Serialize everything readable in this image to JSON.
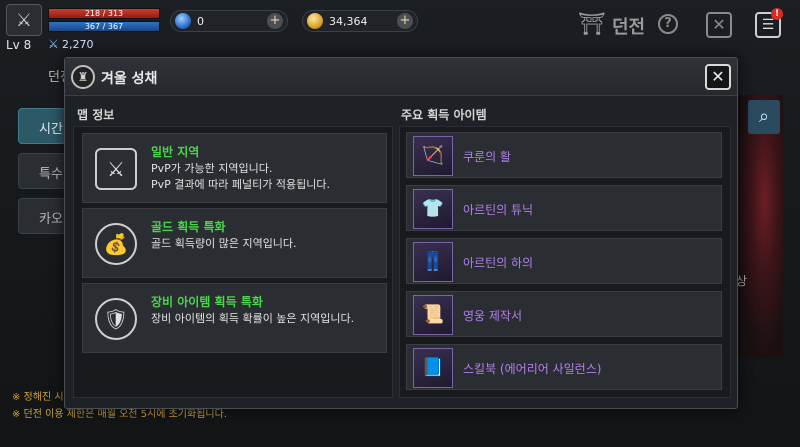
{
  "hud": {
    "hp_text": "218 / 313",
    "hp_fraction": 0.7,
    "mp_text": "367 / 367",
    "mp_fraction": 1.0,
    "level": "Lv 8",
    "power": "2,270",
    "gems": "0",
    "gold": "34,364",
    "dungeon_title": "던전",
    "help_icon": "?",
    "close_icon": "✕",
    "menu_icon": "☰",
    "menu_badge": "!",
    "plus": "+"
  },
  "background": {
    "tab_label": "던전",
    "side_buttons": [
      "시간",
      "특수",
      "카오"
    ],
    "notes": [
      "※ 정해진 시",
      "※ 던전 이용 제한은 매월 오전 5시에 초기화됩니다."
    ],
    "art_letter": "상"
  },
  "modal": {
    "title": "겨울 성채",
    "close_icon": "✕",
    "left_section_title": "맵 정보",
    "right_section_title": "주요 획득 아이템",
    "regions": [
      {
        "title": "일반 지역",
        "desc": "PvP가 가능한 지역입니다.\nPvP 결과에 따라 페널티가 적용됩니다.",
        "icon": "pvp-map-icon",
        "glyph": "⚔"
      },
      {
        "title": "골드 획득 특화",
        "desc": "골드 획득량이 많은 지역입니다.",
        "icon": "gold-bag-icon",
        "glyph": "💰"
      },
      {
        "title": "장비 아이템 획득 특화",
        "desc": "장비 아이템의 획득 확률이 높은 지역입니다.",
        "icon": "equipment-bag-icon",
        "glyph": "🛡"
      }
    ],
    "items": [
      {
        "name": "쿠룬의 활",
        "icon": "bow-icon",
        "glyph": "🏹"
      },
      {
        "name": "아르틴의 튜닉",
        "icon": "tunic-icon",
        "glyph": "👕"
      },
      {
        "name": "아르틴의 하의",
        "icon": "pants-icon",
        "glyph": "👖"
      },
      {
        "name": "영웅 제작서",
        "icon": "scroll-icon",
        "glyph": "📜"
      },
      {
        "name": "스킬북 (에어리어 사일런스)",
        "icon": "skillbook-icon",
        "glyph": "📘"
      }
    ]
  },
  "colors": {
    "region_title": "#4ad64b",
    "item_name": "#b37ff0",
    "note": "#d0a23b"
  }
}
